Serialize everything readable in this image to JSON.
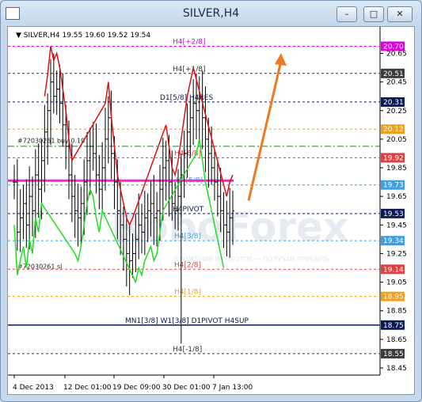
{
  "window": {
    "title": "SILVER,H4",
    "minimize_label": "–",
    "restore_label": "□",
    "close_label": "✕"
  },
  "chart_header": {
    "symbol": "SILVER,H4",
    "ohlc": "19.55 19.60 19.52 19.54"
  },
  "watermark": {
    "brand": "RoboForex",
    "slogan": "ВЛОЖЕНИЯ В РОБОТОВ — ПОЛУЧАЙ ПРИБЫЛЬ"
  },
  "chart_data": {
    "type": "line",
    "symbol": "SILVER",
    "timeframe": "H4",
    "y_range": [
      18.4,
      20.78
    ],
    "y_ticks": [
      "20.65",
      "20.45",
      "20.25",
      "20.05",
      "19.85",
      "19.65",
      "19.45",
      "19.25",
      "19.05",
      "18.85",
      "18.65",
      "18.45"
    ],
    "x_tick_labels": [
      "4 Dec 2013",
      "12 Dec 01:00",
      "19 Dec 09:00",
      "30 Dec 01:00",
      "7 Jan 13:00"
    ],
    "price_levels": [
      {
        "label": "H4[+2/8]",
        "value": 20.7,
        "tag": "20.70",
        "color": "#e100e1",
        "tag_bg": "#e100e1",
        "style": "dashed"
      },
      {
        "label": "H4[+1/8]",
        "value": 20.51,
        "tag": "20.51",
        "color": "#333333",
        "tag_bg": "#3a3a3a",
        "style": "dashed"
      },
      {
        "label": "D1[5/8] H4RES",
        "value": 20.31,
        "tag": "20.31",
        "color": "#0a1a55",
        "tag_bg": "#0a1a55",
        "style": "dashed"
      },
      {
        "label": "",
        "value": 20.12,
        "tag": "20.12",
        "color": "#f0a020",
        "tag_bg": "#f0a020",
        "style": "dashed"
      },
      {
        "label": "",
        "value": 20.0,
        "tag": "",
        "color": "#2a7a2a",
        "tag_bg": "",
        "style": "dashdot"
      },
      {
        "label": "H4[6/8]",
        "value": 19.92,
        "tag": "19.92",
        "color": "#e04040",
        "tag_bg": "#e04040",
        "style": "dashed"
      },
      {
        "label": "H4[5/8]",
        "value": 19.73,
        "tag": "19.73",
        "color": "#3aa0e0",
        "tag_bg": "#3aa0e0",
        "style": "dashed"
      },
      {
        "label": "H4PIVOT",
        "value": 19.53,
        "tag": "19.53",
        "color": "#0a1a55",
        "tag_bg": "#0a1a55",
        "style": "dashed"
      },
      {
        "label": "H4[3/8]",
        "value": 19.34,
        "tag": "19.34",
        "color": "#3aa0e0",
        "tag_bg": "#3aa0e0",
        "style": "dashed"
      },
      {
        "label": "H4[2/8]",
        "value": 19.14,
        "tag": "19.14",
        "color": "#e04040",
        "tag_bg": "#e04040",
        "style": "dashed"
      },
      {
        "label": "H4[1/8]",
        "value": 18.95,
        "tag": "18.95",
        "color": "#f0a020",
        "tag_bg": "#f0a020",
        "style": "dashed"
      },
      {
        "label": "MN1[3/8] W1[3/8] D1PIVOT H4SUP",
        "value": 18.75,
        "tag": "18.75",
        "color": "#0a1a55",
        "tag_bg": "#0a1a55",
        "style": "solid"
      },
      {
        "label": "H4[-1/8]",
        "value": 18.55,
        "tag": "18.55",
        "color": "#333333",
        "tag_bg": "#3a3a3a",
        "style": "dashed"
      }
    ],
    "order_lines": [
      {
        "label": "#72030261 buy 0.10",
        "value": 20.04
      },
      {
        "label": "#72030261 sl",
        "value": 19.16
      }
    ],
    "magenta_line": {
      "value": 19.76
    },
    "price_series": [
      19.75,
      19.4,
      19.5,
      19.6,
      19.45,
      19.65,
      19.55,
      19.8,
      19.7,
      19.9,
      20.1,
      20.25,
      20.45,
      20.35,
      20.4,
      20.3,
      20.15,
      20.0,
      19.8,
      19.65,
      19.55,
      19.5,
      19.6,
      19.75,
      19.9,
      20.0,
      19.95,
      19.8,
      19.7,
      19.85,
      20.05,
      20.2,
      19.95,
      19.75,
      19.55,
      19.45,
      19.35,
      19.25,
      19.2,
      19.25,
      19.35,
      19.45,
      19.4,
      19.5,
      19.55,
      19.6,
      19.5,
      19.55,
      19.7,
      19.85,
      19.9,
      19.75,
      19.6,
      19.55,
      19.65,
      19.8,
      19.95,
      20.1,
      20.2,
      20.3,
      20.25,
      20.35,
      20.2,
      20.05,
      19.95,
      19.85,
      19.75,
      19.65,
      19.55,
      19.45,
      19.4,
      19.5,
      19.55
    ],
    "forecast_arrow": {
      "from_index": 72,
      "from_value": 19.62,
      "to_value": 20.63
    }
  }
}
